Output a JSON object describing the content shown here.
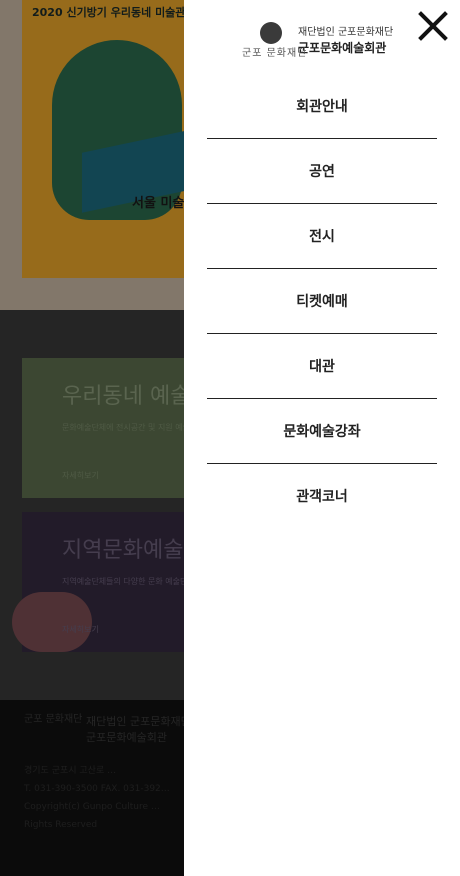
{
  "background": {
    "poster_title": "2020 신기방기 우리동네 미술관",
    "poster_subtitle": "서울 미술",
    "card1_title": "우리동네 예술",
    "card1_text": "문화예술단체에 전시공간 및 지원 예술프로젝트 개발 및 지원",
    "card1_more": "자세히보기",
    "card2_title": "지역문화예술",
    "card2_text": "지역예술단체들의 다양한 문화 예술단체의 역량 강화 및 문화",
    "card2_more": "자세히보기",
    "footer_brand_line1": "재단법인 군포문화재단",
    "footer_brand_line2": "군포문화예술회관",
    "footer_mark": "군포 문화재단",
    "footer_info": "경기도 군포시 고산로 …\nT. 031-390-3500 FAX. 031-392…\nCopyright(c) Gunpo Culture …\nRights Reserved"
  },
  "drawer": {
    "brand_mark": "군포 문화재단",
    "brand_line1": "재단법인 군포문화재단",
    "brand_line2": "군포문화예술회관",
    "menu": [
      {
        "label": "회관안내"
      },
      {
        "label": "공연"
      },
      {
        "label": "전시"
      },
      {
        "label": "티켓예매"
      },
      {
        "label": "대관"
      },
      {
        "label": "문화예술강좌"
      },
      {
        "label": "관객코너"
      }
    ]
  }
}
